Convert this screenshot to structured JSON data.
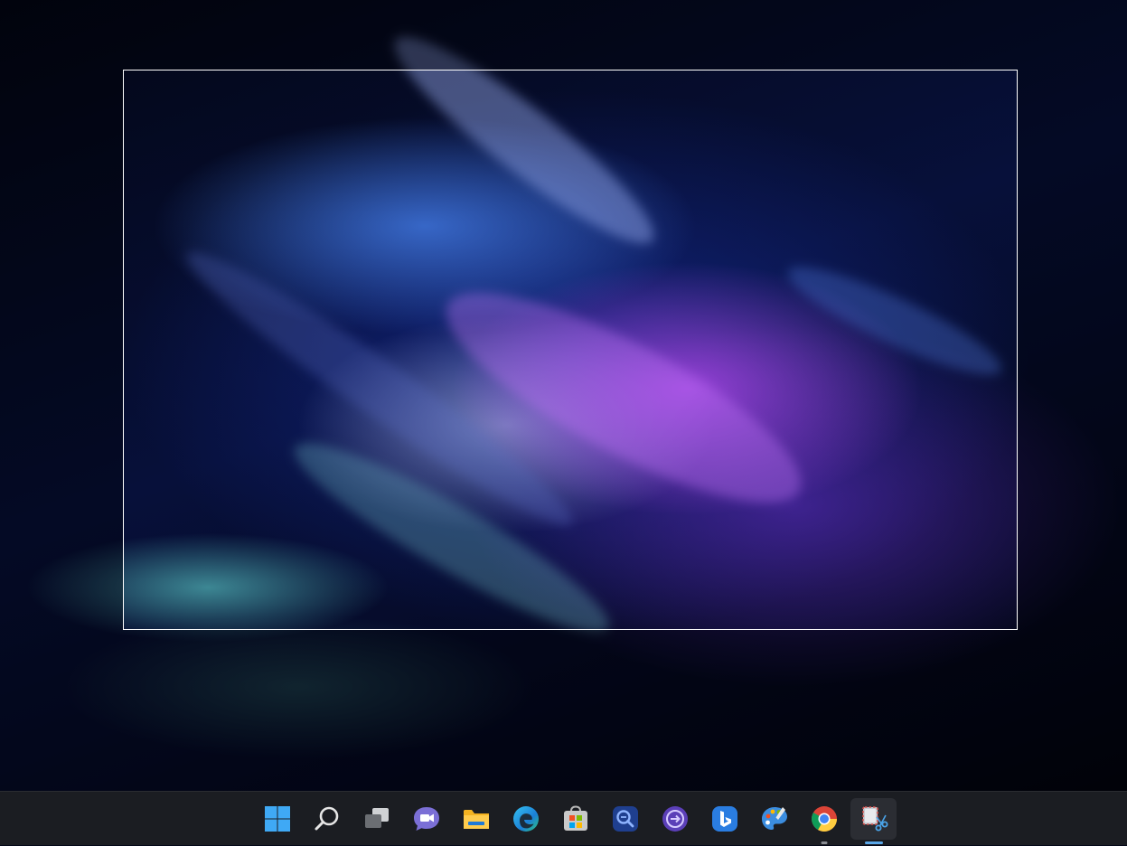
{
  "desktop": {
    "wallpaper": "abstract-particle-wallpaper",
    "snip_overlay": {
      "mode": "rectangular-selection",
      "border_color": "#ffffff"
    }
  },
  "taskbar": {
    "background": "#1b1d22",
    "items": [
      {
        "name": "start-button",
        "icon": "windows-logo-icon",
        "running": false,
        "active": false
      },
      {
        "name": "search-button",
        "icon": "search-icon",
        "running": false,
        "active": false
      },
      {
        "name": "task-view-button",
        "icon": "task-view-icon",
        "running": false,
        "active": false
      },
      {
        "name": "chat-button",
        "icon": "teams-chat-icon",
        "running": false,
        "active": false
      },
      {
        "name": "file-explorer-button",
        "icon": "folder-icon",
        "running": false,
        "active": false
      },
      {
        "name": "edge-button",
        "icon": "edge-icon",
        "running": false,
        "active": false
      },
      {
        "name": "store-button",
        "icon": "microsoft-store-icon",
        "running": false,
        "active": false
      },
      {
        "name": "app-search-button",
        "icon": "magnifier-app-icon",
        "running": false,
        "active": false
      },
      {
        "name": "app-arrow-button",
        "icon": "arrow-circle-icon",
        "running": false,
        "active": false
      },
      {
        "name": "bing-button",
        "icon": "bing-icon",
        "running": false,
        "active": false
      },
      {
        "name": "paint-button",
        "icon": "paint-palette-icon",
        "running": false,
        "active": false
      },
      {
        "name": "chrome-button",
        "icon": "chrome-icon",
        "running": true,
        "active": false
      },
      {
        "name": "snipping-tool-button",
        "icon": "snipping-tool-icon",
        "running": true,
        "active": true
      }
    ],
    "accent": "#5aa7e8"
  }
}
